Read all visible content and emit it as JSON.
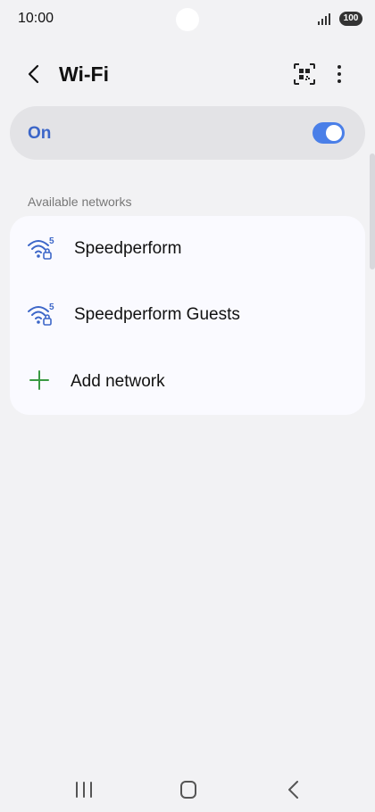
{
  "status_bar": {
    "time": "10:00",
    "battery": "100",
    "icons": [
      "signal-icon",
      "battery-icon"
    ]
  },
  "header": {
    "title": "Wi-Fi",
    "icons": [
      "back-icon",
      "qr-code-scan-icon",
      "more-options-icon"
    ]
  },
  "wifi_toggle": {
    "label": "On",
    "enabled": true
  },
  "available_networks": {
    "title": "Available networks",
    "networks": [
      {
        "name": "Speedperform",
        "band": "5",
        "icon": "wifi-5ghz-locked-icon"
      },
      {
        "name": "Speedperform Guests",
        "band": "5",
        "icon": "wifi-5ghz-locked-icon"
      }
    ],
    "add_label": "Add network"
  },
  "navbar": {
    "icons": [
      "recent-apps-icon",
      "home-icon",
      "back-icon"
    ]
  },
  "colors": {
    "accent": "#3c66c8",
    "switch": "#4a7fe8",
    "background": "#f2f2f4",
    "add_icon": "#3a9a43"
  }
}
